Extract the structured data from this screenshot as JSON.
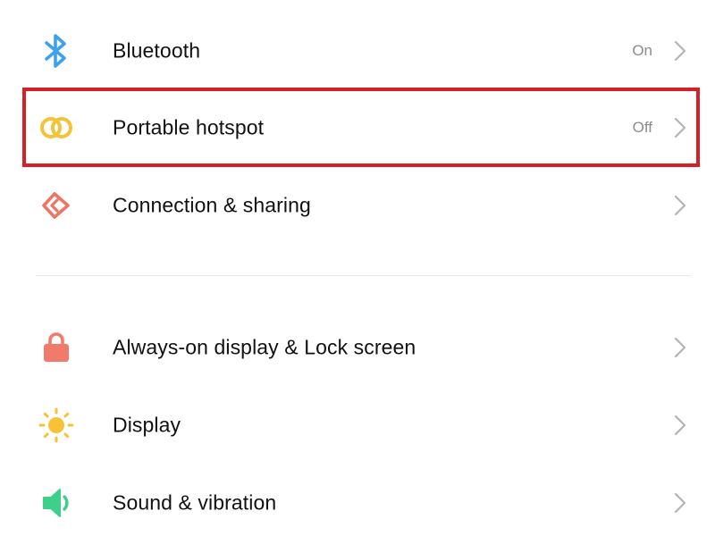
{
  "group1": {
    "items": [
      {
        "label": "Bluetooth",
        "status": "On",
        "icon": "bluetooth-icon",
        "icon_color": "#3ea2ea"
      },
      {
        "label": "Portable hotspot",
        "status": "Off",
        "icon": "hotspot-icon",
        "icon_color": "#f3c437"
      },
      {
        "label": "Connection & sharing",
        "status": "",
        "icon": "connection-sharing-icon",
        "icon_color": "#ee7563"
      }
    ]
  },
  "group2": {
    "items": [
      {
        "label": "Always-on display & Lock screen",
        "status": "",
        "icon": "lock-icon",
        "icon_color": "#f17b6a"
      },
      {
        "label": "Display",
        "status": "",
        "icon": "sun-icon",
        "icon_color": "#f6c336"
      },
      {
        "label": "Sound & vibration",
        "status": "",
        "icon": "speaker-icon",
        "icon_color": "#3ecf8a"
      }
    ]
  },
  "highlight_color": "#d81f26",
  "chevron_color": "#b4b4b4"
}
